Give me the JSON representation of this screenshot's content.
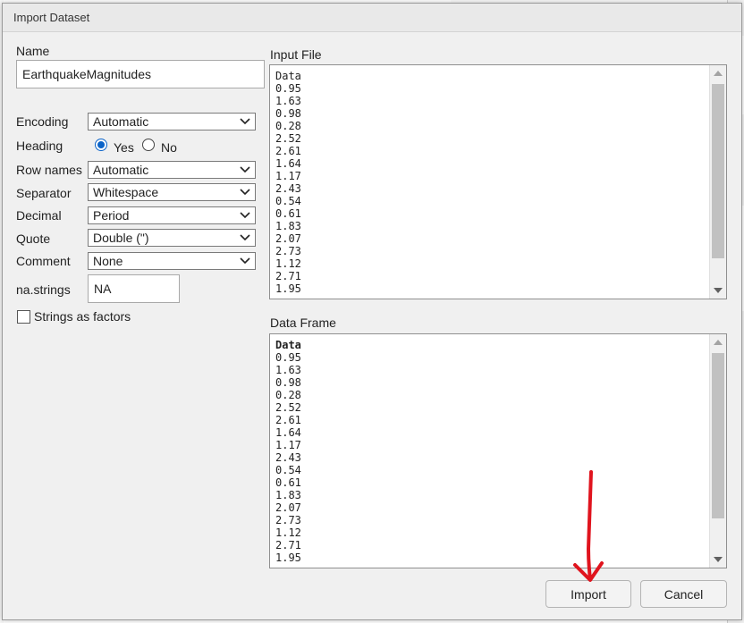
{
  "dialog": {
    "title": "Import Dataset"
  },
  "form": {
    "name_label": "Name",
    "name_value": "EarthquakeMagnitudes",
    "encoding_label": "Encoding",
    "encoding_value": "Automatic",
    "heading_label": "Heading",
    "heading_yes": "Yes",
    "heading_no": "No",
    "heading_selected": "Yes",
    "row_names_label": "Row names",
    "row_names_value": "Automatic",
    "separator_label": "Separator",
    "separator_value": "Whitespace",
    "decimal_label": "Decimal",
    "decimal_value": "Period",
    "quote_label": "Quote",
    "quote_value": "Double (\")",
    "comment_label": "Comment",
    "comment_value": "None",
    "na_strings_label": "na.strings",
    "na_strings_value": "NA",
    "strings_as_factors_label": "Strings as factors",
    "strings_as_factors_checked": false
  },
  "input_file": {
    "label": "Input File",
    "lines": [
      "Data",
      "0.95",
      "1.63",
      "0.98",
      "0.28",
      "2.52",
      "2.61",
      "1.64",
      "1.17",
      "2.43",
      "0.54",
      "0.61",
      "1.83",
      "2.07",
      "2.73",
      "1.12",
      "2.71",
      "1.95"
    ]
  },
  "data_frame": {
    "label": "Data Frame",
    "header": "Data",
    "values": [
      "0.95",
      "1.63",
      "0.98",
      "0.28",
      "2.52",
      "2.61",
      "1.64",
      "1.17",
      "2.43",
      "0.54",
      "0.61",
      "1.83",
      "2.07",
      "2.73",
      "1.12",
      "2.71",
      "1.95"
    ]
  },
  "buttons": {
    "import": "Import",
    "cancel": "Cancel"
  },
  "colors": {
    "accent_radio": "#0b63c8",
    "annotation_arrow": "#e0141e"
  }
}
